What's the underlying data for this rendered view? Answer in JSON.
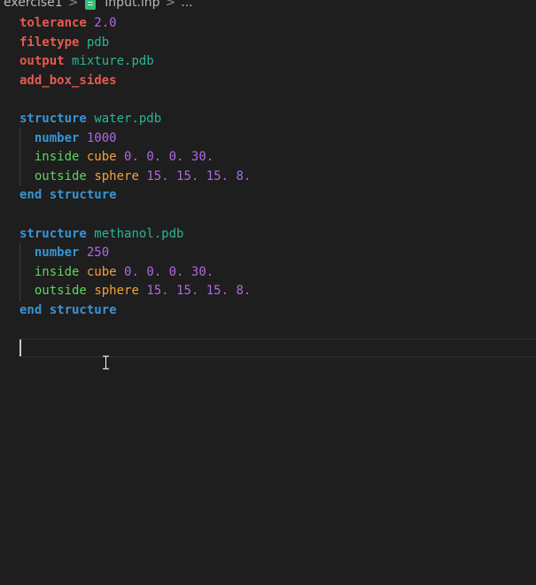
{
  "breadcrumb": {
    "folder": "exercise1",
    "separator": ">",
    "file": "input.inp",
    "ellipsis": "..."
  },
  "editor": {
    "lines": [
      [
        {
          "t": "tolerance",
          "c": "kw-red"
        },
        {
          "t": " "
        },
        {
          "t": "2.0",
          "c": "val-purple"
        }
      ],
      [
        {
          "t": "filetype",
          "c": "kw-red"
        },
        {
          "t": " "
        },
        {
          "t": "pdb",
          "c": "val-teal"
        }
      ],
      [
        {
          "t": "output",
          "c": "kw-red"
        },
        {
          "t": " "
        },
        {
          "t": "mixture.pdb",
          "c": "val-teal"
        }
      ],
      [
        {
          "t": "add_box_sides",
          "c": "kw-red"
        }
      ],
      [],
      [
        {
          "t": "structure",
          "c": "kw-blue"
        },
        {
          "t": " "
        },
        {
          "t": "water.pdb",
          "c": "val-teal"
        }
      ],
      [
        {
          "t": "  "
        },
        {
          "t": "number",
          "c": "kw-blue"
        },
        {
          "t": " "
        },
        {
          "t": "1000",
          "c": "val-purple"
        }
      ],
      [
        {
          "t": "  "
        },
        {
          "t": "inside",
          "c": "kw-green"
        },
        {
          "t": " "
        },
        {
          "t": "cube",
          "c": "kw-orange"
        },
        {
          "t": " "
        },
        {
          "t": "0. 0. 0. 30.",
          "c": "val-purple"
        }
      ],
      [
        {
          "t": "  "
        },
        {
          "t": "outside",
          "c": "kw-green"
        },
        {
          "t": " "
        },
        {
          "t": "sphere",
          "c": "kw-orange"
        },
        {
          "t": " "
        },
        {
          "t": "15. 15. 15. 8.",
          "c": "val-purple"
        }
      ],
      [
        {
          "t": "end structure",
          "c": "kw-blue"
        }
      ],
      [],
      [
        {
          "t": "structure",
          "c": "kw-blue"
        },
        {
          "t": " "
        },
        {
          "t": "methanol.pdb",
          "c": "val-teal"
        }
      ],
      [
        {
          "t": "  "
        },
        {
          "t": "number",
          "c": "kw-blue"
        },
        {
          "t": " "
        },
        {
          "t": "250",
          "c": "val-purple"
        }
      ],
      [
        {
          "t": "  "
        },
        {
          "t": "inside",
          "c": "kw-green"
        },
        {
          "t": " "
        },
        {
          "t": "cube",
          "c": "kw-orange"
        },
        {
          "t": " "
        },
        {
          "t": "0. 0. 0. 30.",
          "c": "val-purple"
        }
      ],
      [
        {
          "t": "  "
        },
        {
          "t": "outside",
          "c": "kw-green"
        },
        {
          "t": " "
        },
        {
          "t": "sphere",
          "c": "kw-orange"
        },
        {
          "t": " "
        },
        {
          "t": "15. 15. 15. 8.",
          "c": "val-purple"
        }
      ],
      [
        {
          "t": "end structure",
          "c": "kw-blue"
        }
      ],
      [],
      []
    ],
    "cursor_line": 18
  },
  "colors": {
    "background": "#1e1e1e",
    "keyword_red": "#e65a4f",
    "keyword_blue": "#3794d4",
    "keyword_green": "#5fd35f",
    "keyword_orange": "#f2a13b",
    "value_purple": "#b267e6",
    "value_teal": "#2bb596"
  },
  "icons": {
    "file": "file-inp-icon",
    "mouse": "ibeam-cursor-icon"
  }
}
